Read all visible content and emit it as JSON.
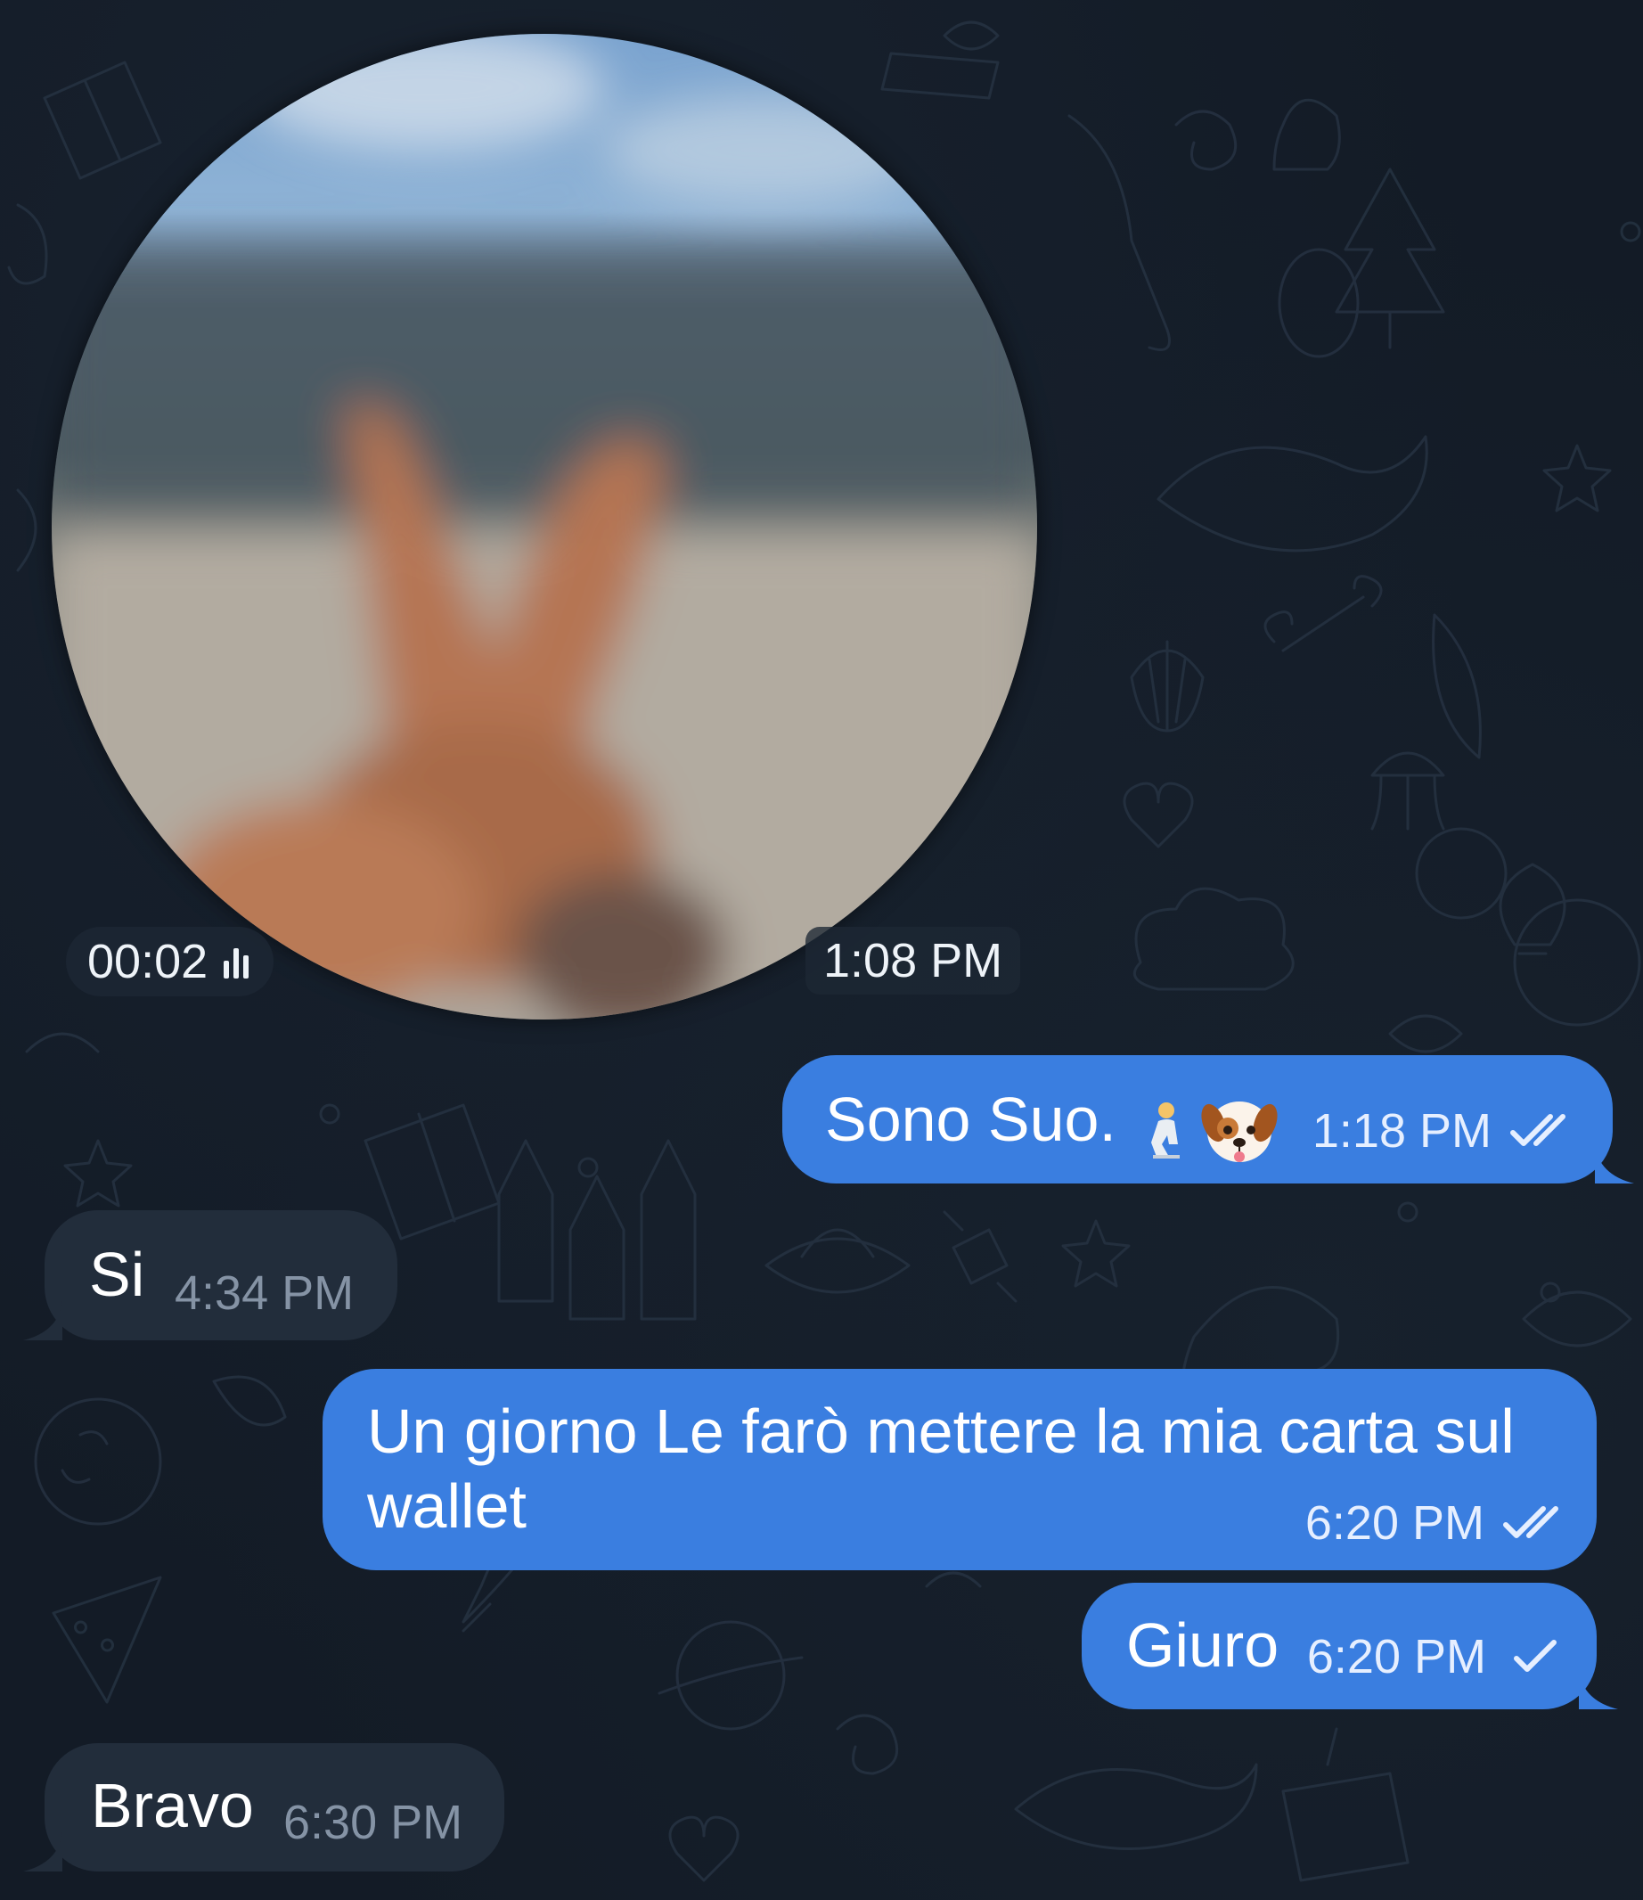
{
  "chat": {
    "video_note": {
      "duration": "00:02",
      "time": "1:08 PM"
    },
    "messages": [
      {
        "direction": "outgoing",
        "text": "Sono Suo.",
        "emoji": [
          "person-kneeling",
          "dog-face"
        ],
        "time": "1:18 PM",
        "status": "read"
      },
      {
        "direction": "incoming",
        "text": "Si",
        "time": "4:34 PM"
      },
      {
        "direction": "outgoing",
        "text_line1": "Un giorno Le farò mettere la mia carta sul",
        "text_line2": "wallet",
        "time": "6:20 PM",
        "status": "read"
      },
      {
        "direction": "outgoing",
        "text": "Giuro",
        "time": "6:20 PM",
        "status": "sent"
      },
      {
        "direction": "incoming",
        "text": "Bravo",
        "time": "6:30 PM"
      }
    ]
  },
  "colors": {
    "background": "#131b26",
    "outgoing_bubble": "#3a7ee0",
    "incoming_bubble": "#222d3b",
    "incoming_time": "#8593a5"
  },
  "icons": {
    "waveform": "bars-icon",
    "read": "double-check-icon",
    "sent": "single-check-icon"
  }
}
